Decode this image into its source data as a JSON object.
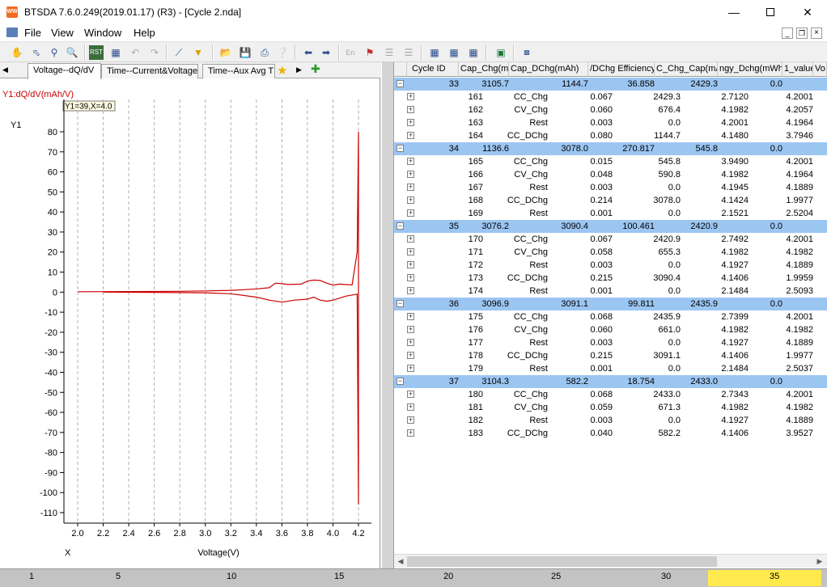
{
  "window": {
    "title": "BTSDA 7.6.0.249(2019.01.17) (R3) - [Cycle 2.nda]",
    "icon_text": "WW",
    "minimize_icon": "minimize-icon",
    "maximize_icon": "maximize-icon",
    "close_icon": "close-icon"
  },
  "menu": {
    "items": [
      "File",
      "View",
      "Window",
      "Help"
    ]
  },
  "tabs": {
    "items": [
      "Voltage--dQ/dV",
      "Time--Current&Voltage",
      "Time--Aux Avg T"
    ]
  },
  "chart": {
    "series_label": "Y1:dQ/dV(mAh/V)",
    "tooltip": "Y1=39,X=4.0",
    "yaxis_name": "Y1",
    "xaxis_name": "X",
    "xlabel": "Voltage(V)",
    "series_color": "#cc0000"
  },
  "chart_data": {
    "type": "line",
    "xlabel": "Voltage(V)",
    "ylabel": "Y1",
    "xlim": [
      1.9,
      4.3
    ],
    "ylim": [
      -115,
      87
    ],
    "xticks": [
      2.0,
      2.2,
      2.4,
      2.6,
      2.8,
      3.0,
      3.2,
      3.4,
      3.6,
      3.8,
      4.0,
      4.2
    ],
    "yticks": [
      80,
      70,
      60,
      50,
      40,
      30,
      20,
      10,
      0,
      -10,
      -20,
      -30,
      -40,
      -50,
      -60,
      -70,
      -80,
      -90,
      -100,
      -110
    ],
    "grid": "vertical",
    "series": [
      {
        "x": [
          2.0,
          2.4,
          2.8,
          3.0,
          3.2,
          3.3,
          3.4,
          3.5,
          3.55,
          3.6,
          3.65,
          3.75,
          3.8,
          3.85,
          3.9,
          3.95,
          4.0,
          4.05,
          4.1,
          4.15,
          4.19,
          4.2,
          4.2
        ],
        "y": [
          0.2,
          0.3,
          0.4,
          0.6,
          0.9,
          1.2,
          1.6,
          2.2,
          4.5,
          4.2,
          3.8,
          4.0,
          5.5,
          6.0,
          5.8,
          4.5,
          3.5,
          4.0,
          3.8,
          3.6,
          20.0,
          80.0,
          2.0
        ]
      },
      {
        "x": [
          4.2,
          4.2,
          4.19,
          4.1,
          4.05,
          4.0,
          3.95,
          3.9,
          3.85,
          3.8,
          3.7,
          3.6,
          3.5,
          3.4,
          3.2,
          3.0,
          2.6,
          2.2
        ],
        "y": [
          2.0,
          -106.0,
          -1.0,
          -2.0,
          -3.0,
          -4.0,
          -4.5,
          -4.0,
          -2.5,
          -3.5,
          -4.0,
          -5.0,
          -4.0,
          -2.5,
          -0.8,
          -0.3,
          -0.1,
          0.0
        ]
      }
    ]
  },
  "grid": {
    "columns": [
      "Cycle ID",
      "Cap_Chg(mAh)",
      "Cap_DChg(mAh)",
      "/DChg Efficiency",
      "C_Chg_Cap(mAh",
      "ngy_Dchg(mWh)",
      "1_value",
      "Vo"
    ],
    "rows": [
      {
        "type": "cycle",
        "c": [
          "33",
          "3105.7",
          "1144.7",
          "36.858",
          "2429.3",
          "0.0"
        ]
      },
      {
        "type": "step",
        "c": [
          "161",
          "CC_Chg",
          "0.067",
          "2429.3",
          "2.7120",
          "4.2001"
        ]
      },
      {
        "type": "step",
        "c": [
          "162",
          "CV_Chg",
          "0.060",
          "676.4",
          "4.1982",
          "4.2057"
        ]
      },
      {
        "type": "step",
        "c": [
          "163",
          "Rest",
          "0.003",
          "0.0",
          "4.2001",
          "4.1964"
        ]
      },
      {
        "type": "step",
        "c": [
          "164",
          "CC_DChg",
          "0.080",
          "1144.7",
          "4.1480",
          "3.7946"
        ]
      },
      {
        "type": "cycle",
        "c": [
          "34",
          "1136.6",
          "3078.0",
          "270.817",
          "545.8",
          "0.0"
        ]
      },
      {
        "type": "step",
        "c": [
          "165",
          "CC_Chg",
          "0.015",
          "545.8",
          "3.9490",
          "4.2001"
        ]
      },
      {
        "type": "step",
        "c": [
          "166",
          "CV_Chg",
          "0.048",
          "590.8",
          "4.1982",
          "4.1964"
        ]
      },
      {
        "type": "step",
        "c": [
          "167",
          "Rest",
          "0.003",
          "0.0",
          "4.1945",
          "4.1889"
        ]
      },
      {
        "type": "step",
        "c": [
          "168",
          "CC_DChg",
          "0.214",
          "3078.0",
          "4.1424",
          "1.9977"
        ]
      },
      {
        "type": "step",
        "c": [
          "169",
          "Rest",
          "0.001",
          "0.0",
          "2.1521",
          "2.5204"
        ]
      },
      {
        "type": "cycle",
        "c": [
          "35",
          "3076.2",
          "3090.4",
          "100.461",
          "2420.9",
          "0.0"
        ]
      },
      {
        "type": "step",
        "c": [
          "170",
          "CC_Chg",
          "0.067",
          "2420.9",
          "2.7492",
          "4.2001"
        ]
      },
      {
        "type": "step",
        "c": [
          "171",
          "CV_Chg",
          "0.058",
          "655.3",
          "4.1982",
          "4.1982"
        ]
      },
      {
        "type": "step",
        "c": [
          "172",
          "Rest",
          "0.003",
          "0.0",
          "4.1927",
          "4.1889"
        ]
      },
      {
        "type": "step",
        "c": [
          "173",
          "CC_DChg",
          "0.215",
          "3090.4",
          "4.1406",
          "1.9959"
        ]
      },
      {
        "type": "step",
        "c": [
          "174",
          "Rest",
          "0.001",
          "0.0",
          "2.1484",
          "2.5093"
        ]
      },
      {
        "type": "cycle",
        "c": [
          "36",
          "3096.9",
          "3091.1",
          "99.811",
          "2435.9",
          "0.0"
        ]
      },
      {
        "type": "step",
        "c": [
          "175",
          "CC_Chg",
          "0.068",
          "2435.9",
          "2.7399",
          "4.2001"
        ]
      },
      {
        "type": "step",
        "c": [
          "176",
          "CV_Chg",
          "0.060",
          "661.0",
          "4.1982",
          "4.1982"
        ]
      },
      {
        "type": "step",
        "c": [
          "177",
          "Rest",
          "0.003",
          "0.0",
          "4.1927",
          "4.1889"
        ]
      },
      {
        "type": "step",
        "c": [
          "178",
          "CC_DChg",
          "0.215",
          "3091.1",
          "4.1406",
          "1.9977"
        ]
      },
      {
        "type": "step",
        "c": [
          "179",
          "Rest",
          "0.001",
          "0.0",
          "2.1484",
          "2.5037"
        ]
      },
      {
        "type": "cycle",
        "c": [
          "37",
          "3104.3",
          "582.2",
          "18.754",
          "2433.0",
          "0.0"
        ]
      },
      {
        "type": "step",
        "c": [
          "180",
          "CC_Chg",
          "0.068",
          "2433.0",
          "2.7343",
          "4.2001"
        ]
      },
      {
        "type": "step",
        "c": [
          "181",
          "CV_Chg",
          "0.059",
          "671.3",
          "4.1982",
          "4.1982"
        ]
      },
      {
        "type": "step",
        "c": [
          "182",
          "Rest",
          "0.003",
          "0.0",
          "4.1927",
          "4.1889"
        ]
      },
      {
        "type": "step",
        "c": [
          "183",
          "CC_DChg",
          "0.040",
          "582.2",
          "4.1406",
          "3.9527"
        ]
      }
    ]
  },
  "statusbar": {
    "ticks": [
      "1",
      "5",
      "10",
      "15",
      "20",
      "25",
      "30",
      "35"
    ],
    "highlight_color": "#ffe94d"
  }
}
